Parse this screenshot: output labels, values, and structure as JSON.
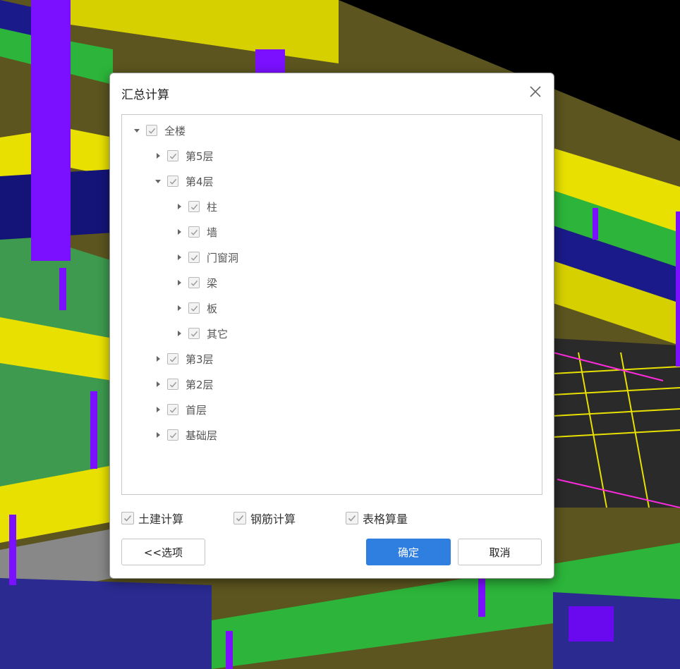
{
  "dialog": {
    "title": "汇总计算",
    "tree": [
      {
        "label": "全楼",
        "level": 0,
        "expanded": true,
        "checked": true
      },
      {
        "label": "第5层",
        "level": 1,
        "expanded": false,
        "checked": true
      },
      {
        "label": "第4层",
        "level": 1,
        "expanded": true,
        "checked": true
      },
      {
        "label": "柱",
        "level": 2,
        "expanded": false,
        "checked": true
      },
      {
        "label": "墙",
        "level": 2,
        "expanded": false,
        "checked": true
      },
      {
        "label": "门窗洞",
        "level": 2,
        "expanded": false,
        "checked": true
      },
      {
        "label": "梁",
        "level": 2,
        "expanded": false,
        "checked": true
      },
      {
        "label": "板",
        "level": 2,
        "expanded": false,
        "checked": true
      },
      {
        "label": "其它",
        "level": 2,
        "expanded": false,
        "checked": true
      },
      {
        "label": "第3层",
        "level": 1,
        "expanded": false,
        "checked": true
      },
      {
        "label": "第2层",
        "level": 1,
        "expanded": false,
        "checked": true
      },
      {
        "label": "首层",
        "level": 1,
        "expanded": false,
        "checked": true
      },
      {
        "label": "基础层",
        "level": 1,
        "expanded": false,
        "checked": true
      }
    ],
    "options": [
      {
        "label": "土建计算",
        "checked": true
      },
      {
        "label": "钢筋计算",
        "checked": true
      },
      {
        "label": "表格算量",
        "checked": true
      }
    ],
    "buttons": {
      "options_label": "<<选项",
      "ok_label": "确定",
      "cancel_label": "取消"
    }
  },
  "colors": {
    "primary": "#2f7fe0",
    "check": "#9a9a9a",
    "beam_yellow": "#e8e000",
    "column_purple": "#7a10ff",
    "slab_olive": "#5c5520",
    "wall_blue": "#1e1e8c",
    "green": "#2cb53a"
  }
}
